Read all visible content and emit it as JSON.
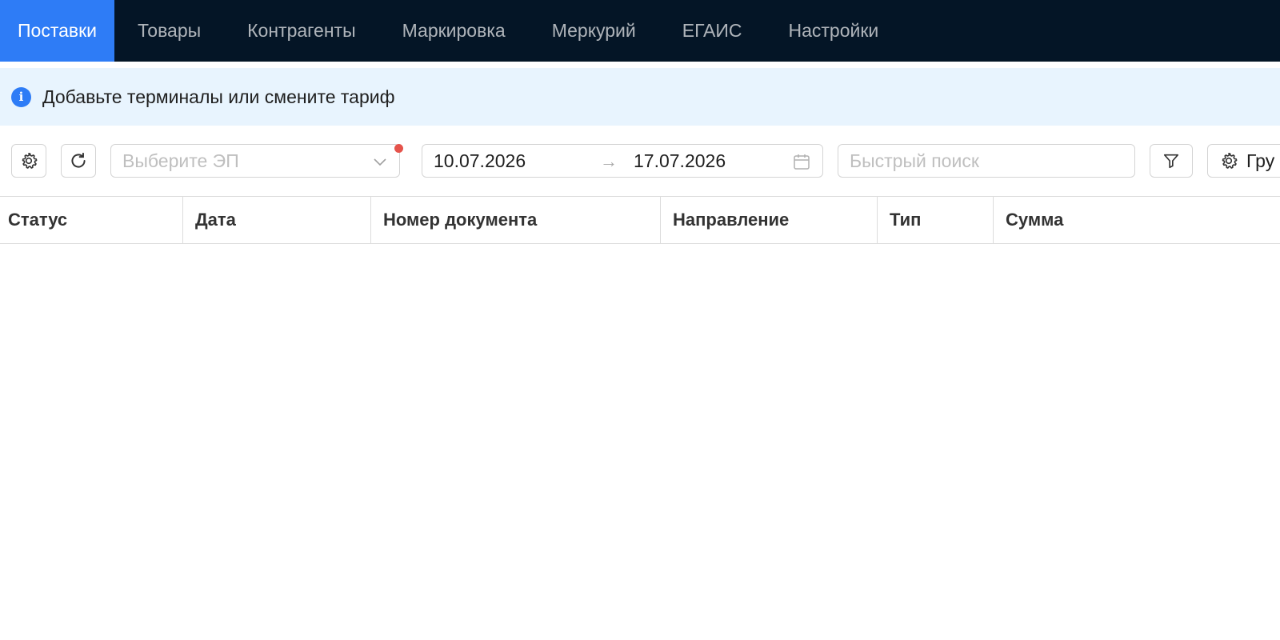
{
  "nav": {
    "tabs": [
      {
        "label": "Поставки",
        "active": true
      },
      {
        "label": "Товары"
      },
      {
        "label": "Контрагенты"
      },
      {
        "label": "Маркировка"
      },
      {
        "label": "Меркурий"
      },
      {
        "label": "ЕГАИС"
      },
      {
        "label": "Настройки"
      }
    ]
  },
  "notice": {
    "icon": "info-icon",
    "text": "Добавьте терминалы или смените тариф"
  },
  "toolbar": {
    "settings_icon": "gear-icon",
    "refresh_icon": "refresh-icon",
    "ep_select": {
      "placeholder": "Выберите ЭП",
      "has_indicator": true
    },
    "date_range": {
      "from": "10.07.2026",
      "to": "17.07.2026"
    },
    "search": {
      "placeholder": "Быстрый поиск"
    },
    "filter_icon": "filter-icon",
    "group_button": {
      "label": "Гру"
    }
  },
  "table": {
    "columns": [
      "Статус",
      "Дата",
      "Номер документа",
      "Направление",
      "Тип",
      "Сумма"
    ],
    "rows": []
  },
  "colors": {
    "nav_bg": "#041526",
    "accent": "#2e7cf6",
    "notice_bg": "#e8f4fe",
    "indicator": "#e5534b"
  }
}
